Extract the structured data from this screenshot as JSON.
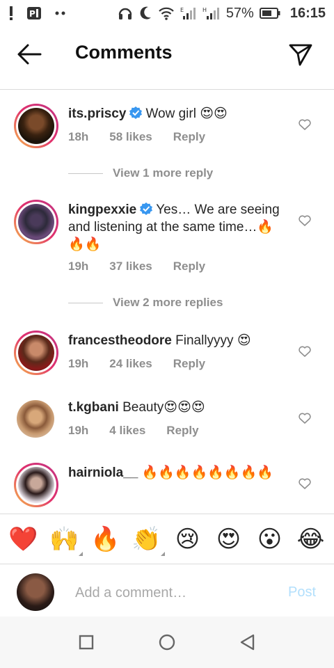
{
  "status_bar": {
    "battery": "57%",
    "time": "16:15"
  },
  "header": {
    "title": "Comments"
  },
  "comments": [
    {
      "username": "its.priscy",
      "verified": true,
      "text": "Wow girl 😍😍",
      "time": "18h",
      "likes": "58 likes",
      "reply": "Reply",
      "view_more": "View 1 more reply"
    },
    {
      "username": "kingpexxie",
      "verified": true,
      "text": "Yes… We are seeing and listening at the same time…🔥🔥🔥",
      "time": "19h",
      "likes": "37 likes",
      "reply": "Reply",
      "view_more": "View 2 more replies"
    },
    {
      "username": "francestheodore",
      "verified": false,
      "text": "Finallyyyy 😍",
      "time": "19h",
      "likes": "24 likes",
      "reply": "Reply"
    },
    {
      "username": "t.kgbani",
      "verified": false,
      "text": "Beauty😍😍😍",
      "time": "19h",
      "likes": "4 likes",
      "reply": "Reply"
    },
    {
      "username": "hairniola__",
      "verified": false,
      "text": "🔥🔥🔥🔥🔥🔥🔥🔥"
    }
  ],
  "reactions": [
    "❤️",
    "🙌",
    "🔥",
    "👏",
    "😢",
    "😍",
    "😮",
    "😂"
  ],
  "composer": {
    "placeholder": "Add a comment…",
    "post_label": "Post"
  },
  "colors": {
    "verified_blue": "#3897f0",
    "post_disabled": "#b2dffc",
    "meta_gray": "#8e8e8e"
  }
}
